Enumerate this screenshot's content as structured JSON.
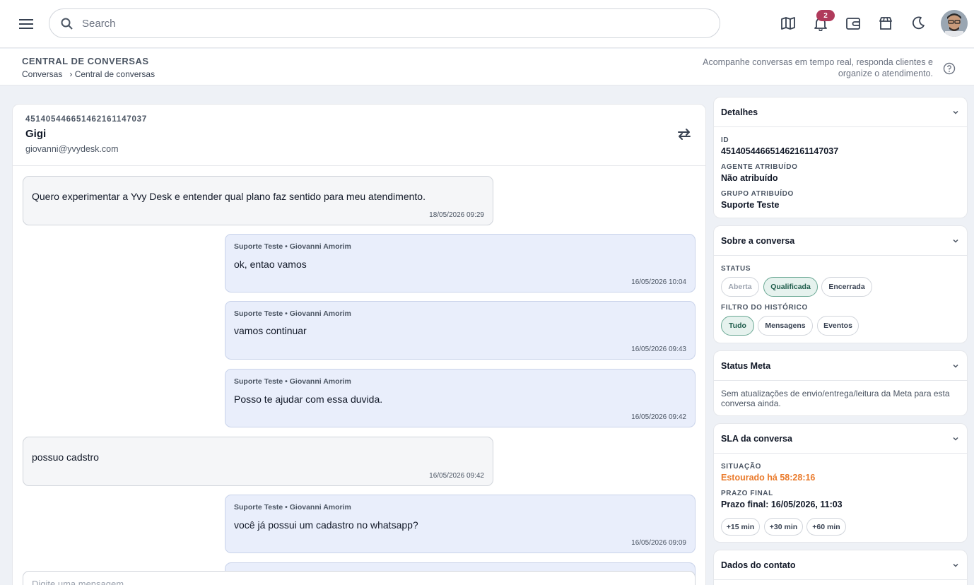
{
  "topbar": {
    "search_placeholder": "Search",
    "notification_count": "2",
    "icons": [
      "menu-icon",
      "search-icon",
      "map-icon",
      "bell-icon",
      "wallet-icon",
      "store-icon",
      "moon-icon"
    ]
  },
  "page": {
    "title": "CENTRAL DE CONVERSAS",
    "breadcrumb": [
      "Conversas",
      "› Central de conversas"
    ],
    "description": "Acompanhe conversas em tempo real, responda clientes e organize o atendimento."
  },
  "conversation": {
    "id": "451405446651462161147037",
    "name": "Gigi",
    "email": "giovanni@yvydesk.com",
    "messages": [
      {
        "direction": "in",
        "text": "Quero experimentar a Yvy Desk e entender qual plano faz sentido para meu atendimento.",
        "time": "18/05/2026 09:29"
      },
      {
        "direction": "out",
        "sender": "Suporte Teste • Giovanni Amorim",
        "text": "ok, entao vamos",
        "time": "16/05/2026 10:04"
      },
      {
        "direction": "out",
        "sender": "Suporte Teste • Giovanni Amorim",
        "text": "vamos continuar",
        "time": "16/05/2026 09:43"
      },
      {
        "direction": "out",
        "sender": "Suporte Teste • Giovanni Amorim",
        "text": "Posso te ajudar com essa duvida.",
        "time": "16/05/2026 09:42"
      },
      {
        "direction": "in",
        "text": "possuo cadstro",
        "time": "16/05/2026 09:42"
      },
      {
        "direction": "out",
        "sender": "Suporte Teste • Giovanni Amorim",
        "text": "você já possui um cadastro no whatsapp?",
        "time": "16/05/2026 09:09"
      }
    ],
    "composer_placeholder": "Digite uma mensagem..."
  },
  "details": {
    "title": "Detalhes",
    "id_label": "ID",
    "id_value": "451405446651462161147037",
    "agent_label": "AGENTE ATRIBUÍDO",
    "agent_value": "Não atribuído",
    "group_label": "GRUPO ATRIBUÍDO",
    "group_value": "Suporte Teste"
  },
  "about": {
    "title": "Sobre a conversa",
    "status_label": "STATUS",
    "status_options": [
      "Aberta",
      "Qualificada",
      "Encerrada"
    ],
    "status_selected": "Qualificada",
    "history_label": "FILTRO DO HISTÓRICO",
    "history_options": [
      "Tudo",
      "Mensagens",
      "Eventos"
    ],
    "history_selected": "Tudo"
  },
  "meta": {
    "title": "Status Meta",
    "text": "Sem atualizações de envio/entrega/leitura da Meta para esta conversa ainda."
  },
  "sla": {
    "title": "SLA da conversa",
    "situation_label": "SITUAÇÃO",
    "situation_value": "Estourado há 58:28:16",
    "situation_color": "#ea7a2b",
    "deadline_label": "PRAZO FINAL",
    "deadline_value": "Prazo final: 16/05/2026, 11:03",
    "buttons": [
      "+15 min",
      "+30 min",
      "+60 min"
    ]
  },
  "contact": {
    "title": "Dados do contato"
  },
  "colors": {
    "accent_badge": "#b03a5b",
    "chip_active_bg": "#e6f2ee",
    "outgoing_bubble": "#e9eefb"
  }
}
